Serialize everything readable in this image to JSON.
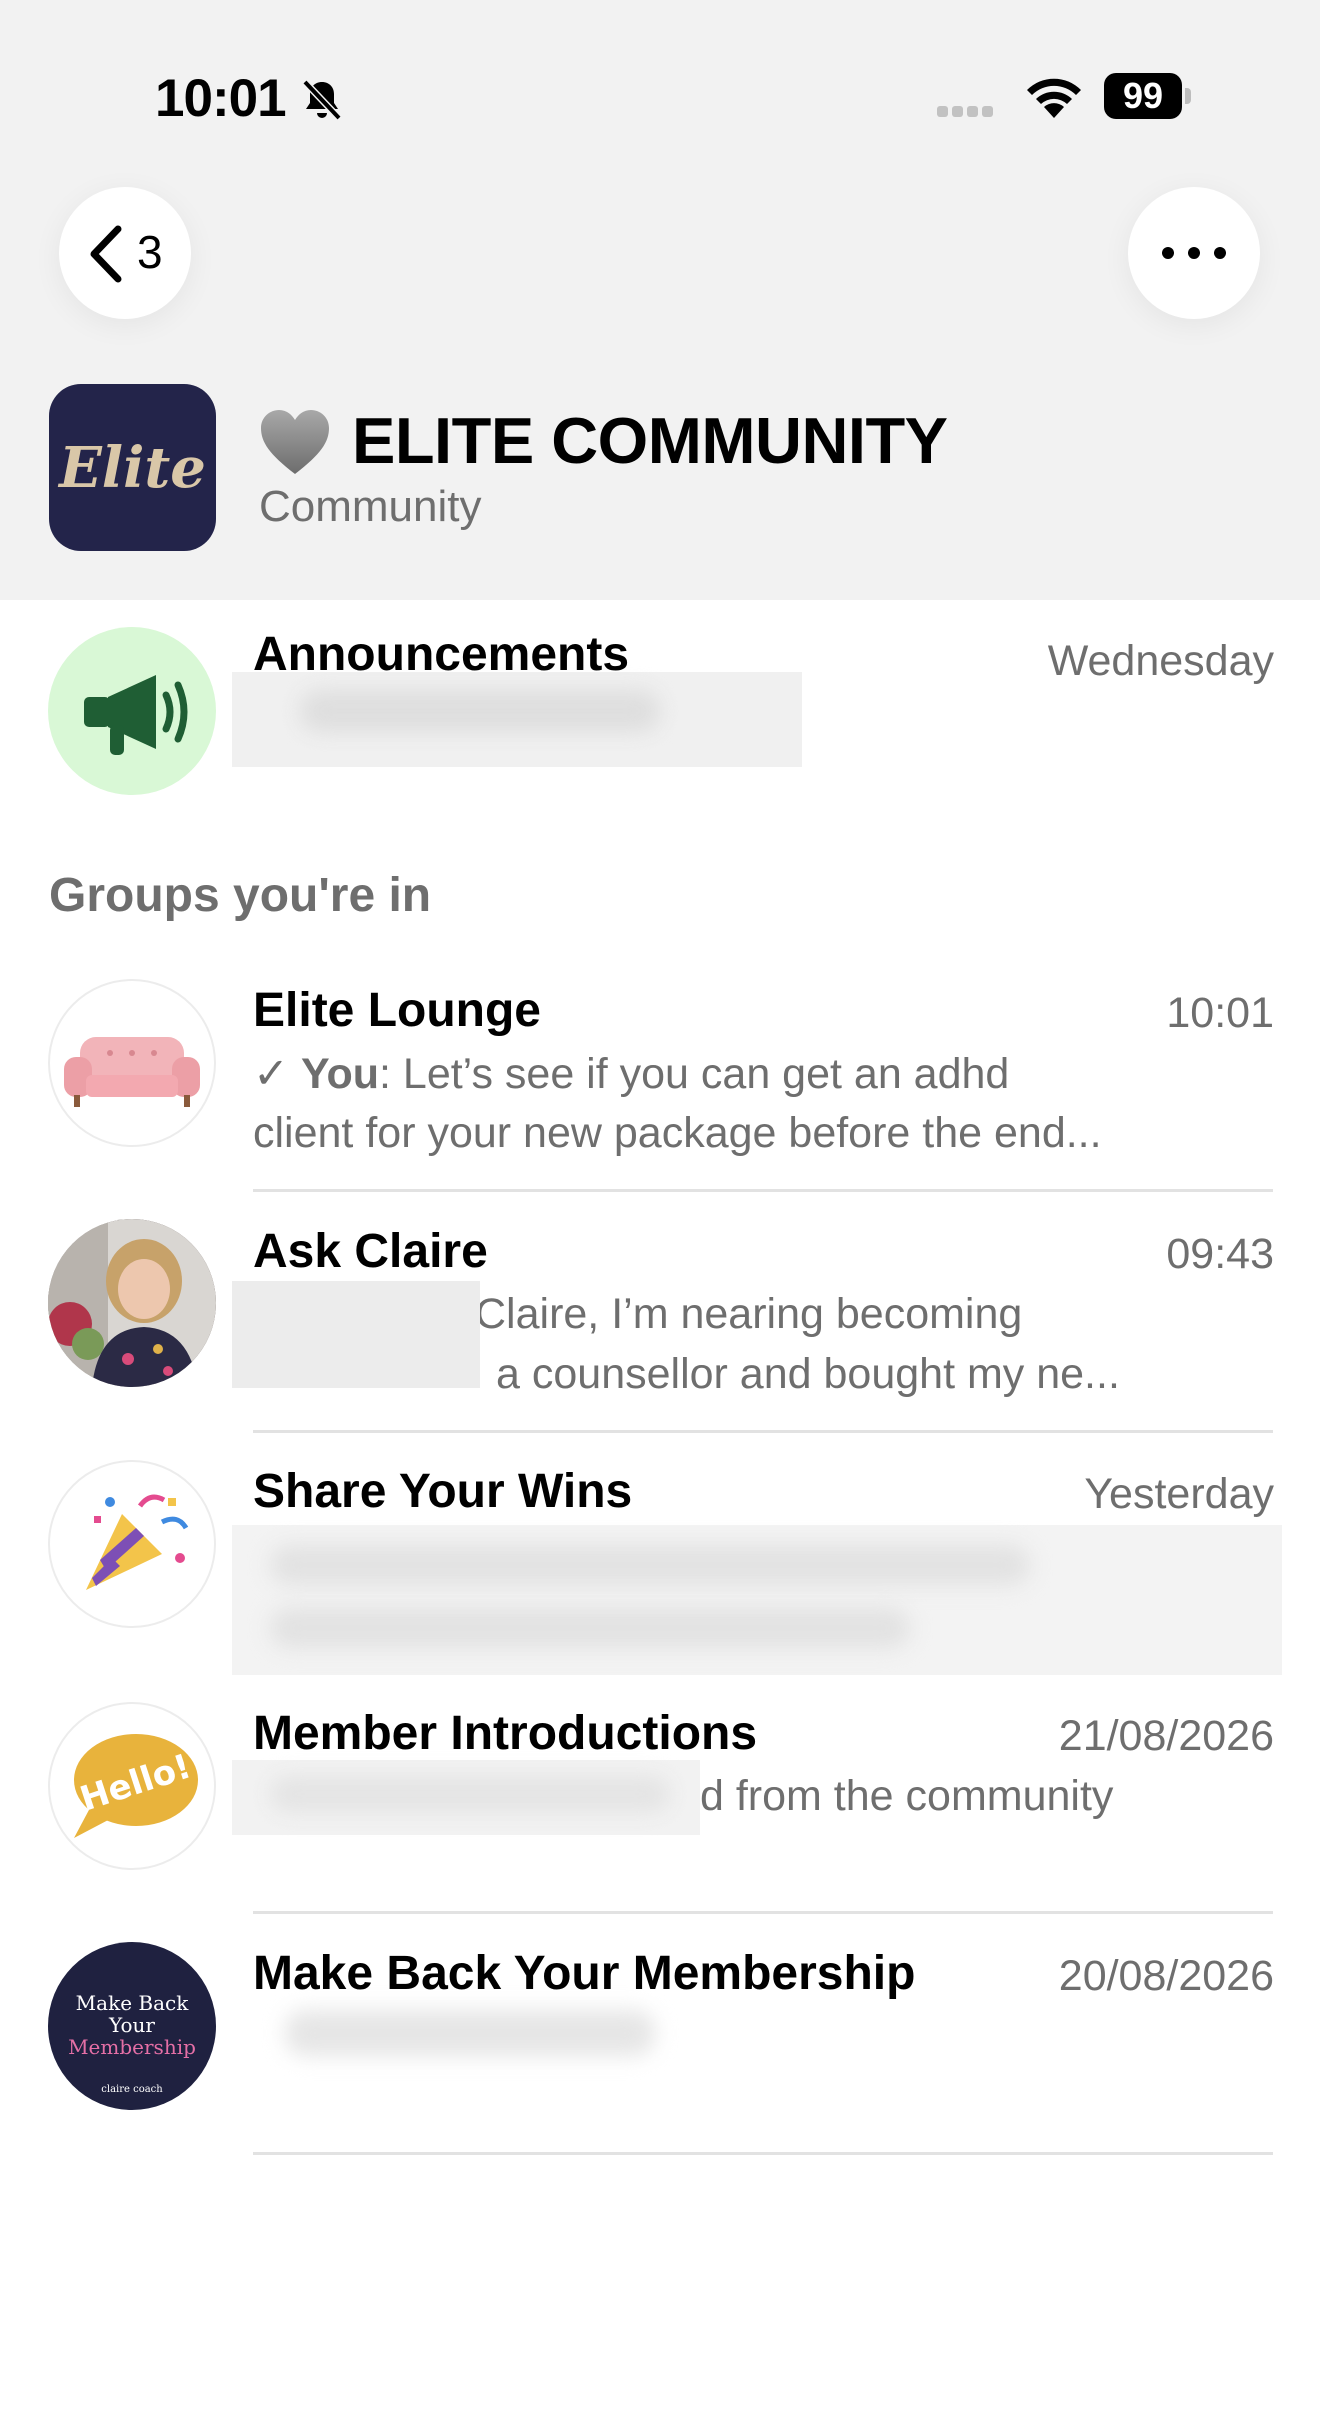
{
  "status_bar": {
    "time": "10:01",
    "battery": "99"
  },
  "nav": {
    "back_count": "3"
  },
  "community": {
    "logo_text": "Elite",
    "title": "ELITE COMMUNITY",
    "subtitle": "Community"
  },
  "announcements": {
    "title": "Announcements",
    "time": "Wednesday"
  },
  "section_label": "Groups you're in",
  "groups": [
    {
      "title": "Elite Lounge",
      "time": "10:01",
      "sender": "You",
      "preview_1": ": Let’s see if you can get an adhd",
      "preview_2": "client for your new package before the end..."
    },
    {
      "title": "Ask Claire",
      "time": "09:43",
      "preview_1": "Claire, I’m nearing becoming",
      "preview_2": "a counsellor and bought my ne..."
    },
    {
      "title": "Share Your Wins",
      "time": "Yesterday"
    },
    {
      "title": "Member Introductions",
      "time": "21/08/2026",
      "preview_1": "d from the community",
      "avatar_text": "Hello!"
    },
    {
      "title": "Make Back Your Membership",
      "time": "20/08/2026",
      "avatar_line1": "Make Back",
      "avatar_line2": "Your",
      "avatar_line3": "Membership",
      "avatar_small": "claire coach"
    }
  ],
  "colors": {
    "accent_green": "#1f5e34",
    "announce_bg": "#d9f8d6",
    "elite_navy": "#23244a",
    "muted_text": "#6e6e6e"
  }
}
